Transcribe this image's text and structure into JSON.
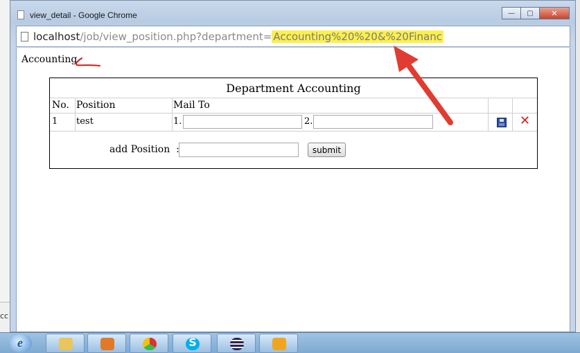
{
  "window": {
    "title": "view_detail - Google Chrome",
    "controls": {
      "minimize": "—",
      "maximize": "▢",
      "close": "✕"
    }
  },
  "address_bar": {
    "host": "localhost",
    "path": "/job/view_position.php?department=",
    "highlighted_query": "Accounting%20%20&%20Financ"
  },
  "page": {
    "department_label": "Accounting",
    "table": {
      "title": "Department Accounting",
      "headers": {
        "no": "No.",
        "position": "Position",
        "mail_to": "Mail To"
      },
      "rows": [
        {
          "no": "1",
          "position": "test",
          "mail1_prefix": "1.",
          "mail2_prefix": "2."
        }
      ],
      "save_icon": "floppy-disk-icon",
      "delete_icon": "✕",
      "add_position": {
        "label": "add Position",
        "separator": ":",
        "submit": "submit"
      }
    }
  },
  "background_left_text": "cc",
  "annotation_colors": {
    "arrow": "#e03c31",
    "scribble": "#d31a1a",
    "highlight": "#fbf04c"
  },
  "taskbar": {
    "start_glyph": "e",
    "items": [
      "explorer-icon",
      "media-player-icon",
      "chrome-icon",
      "skype-icon",
      "eclipse-icon",
      "outlook-icon"
    ]
  }
}
